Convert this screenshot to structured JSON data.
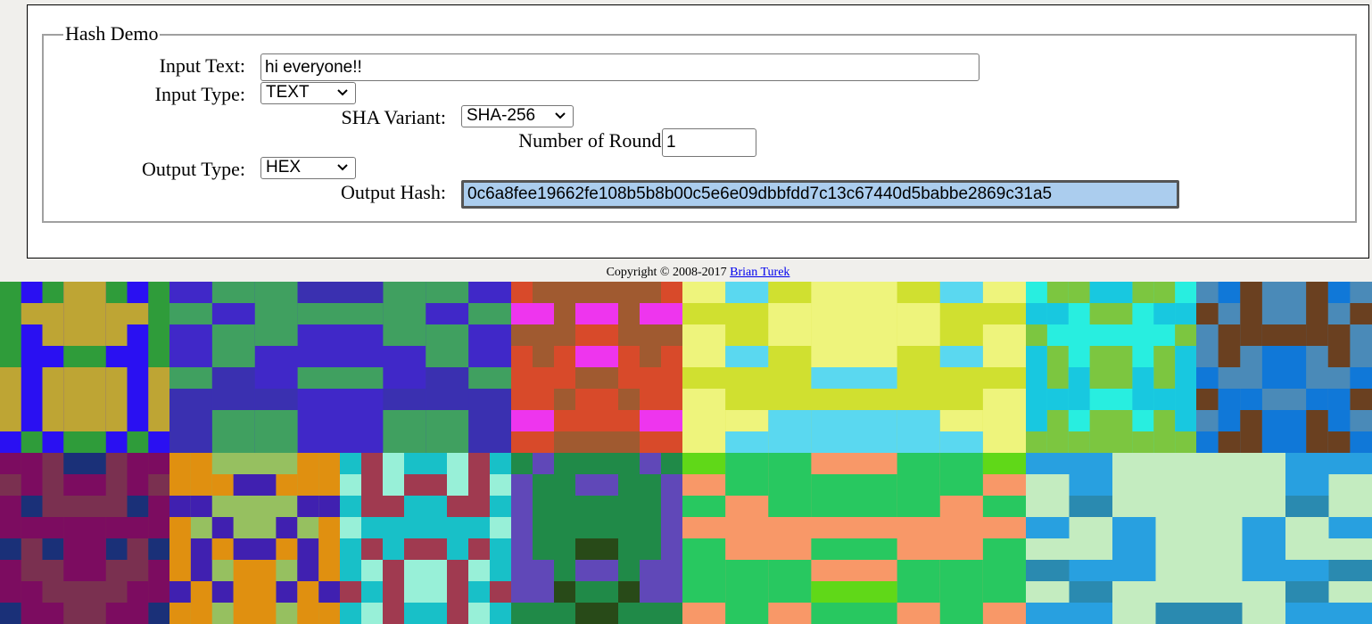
{
  "form": {
    "legend": "Hash Demo",
    "input_text_label": "Input Text:",
    "input_text_value": "hi everyone!!",
    "input_type_label": "Input Type:",
    "input_type_value": "TEXT",
    "sha_variant_label": "SHA Variant:",
    "sha_variant_value": "SHA-256",
    "rounds_label": "Number of Rounds:",
    "rounds_value": "1",
    "output_type_label": "Output Type:",
    "output_type_value": "HEX",
    "output_hash_label": "Output Hash:",
    "output_hash_value": "0c6a8fee19662fe108b5b8b00c5e6e09dbbfdd7c13c67440d5babbe2869c31a5"
  },
  "footer": {
    "copyright_text": "Copyright © 2008-2017",
    "author_link": "Brian Turek"
  },
  "colors": {
    "page_bg": "#f0efec",
    "output_highlight": "#abcdee",
    "link": "#0000ee"
  },
  "icons": {
    "select_arrow": "chevron-down-icon"
  },
  "identicons": [
    {
      "colors": [
        "#2a10f2",
        "#bea534",
        "#2f9c3a"
      ]
    },
    {
      "colors": [
        "#4028c8",
        "#40a060",
        "#3a30b0"
      ]
    },
    {
      "colors": [
        "#a05a30",
        "#d84a2a",
        "#ee35ee"
      ]
    },
    {
      "colors": [
        "#d0e030",
        "#eef47c",
        "#5ad8f0"
      ]
    },
    {
      "colors": [
        "#28eee0",
        "#7cc640",
        "#18c8e0"
      ]
    },
    {
      "colors": [
        "#4a8ab8",
        "#6a4020",
        "#1078d8"
      ]
    },
    {
      "colors": [
        "#7a3050",
        "#7c0c60",
        "#1a3078"
      ]
    },
    {
      "colors": [
        "#96c060",
        "#4020b0",
        "#e09010"
      ]
    },
    {
      "colors": [
        "#18c0c8",
        "#a03a50",
        "#98f0d8"
      ]
    },
    {
      "colors": [
        "#6048b8",
        "#208a48",
        "#284a18"
      ]
    },
    {
      "colors": [
        "#f89868",
        "#28c860",
        "#60d818"
      ]
    },
    {
      "colors": [
        "#28a0e0",
        "#c4ecc0",
        "#2a8ab0"
      ]
    }
  ]
}
